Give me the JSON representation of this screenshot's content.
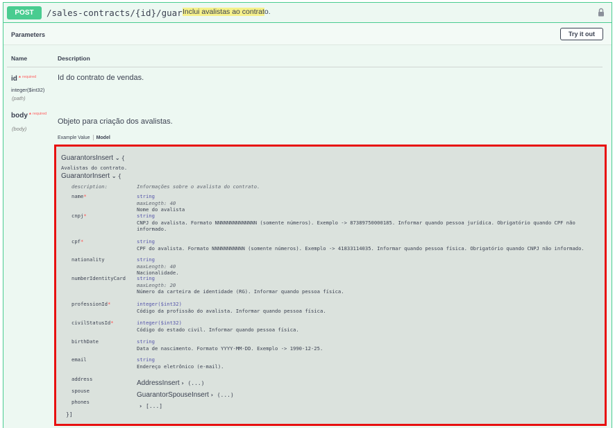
{
  "operation": {
    "method": "POST",
    "path": "/sales-contracts/{id}/guarantors",
    "summary_hl": "Inclui avalistas ao contrat",
    "summary_rest": "o.",
    "icons": {
      "lock": "lock-icon"
    },
    "colors": {
      "method": "#49cc90",
      "highlight": "#f5f08a",
      "outline": "#e81010"
    }
  },
  "parameters": {
    "title": "Parameters",
    "try_label": "Try it out",
    "col_name": "Name",
    "col_desc": "Description",
    "items": [
      {
        "name": "id",
        "star": "*",
        "required": "required",
        "type": "integer($int32)",
        "in": "(path)",
        "description": "Id do contrato de vendas."
      },
      {
        "name": "body",
        "star": "*",
        "required": "required",
        "type": "",
        "in": "(body)",
        "description": "Objeto para criação dos avalistas."
      }
    ]
  },
  "tabs": {
    "example": "Example Value",
    "model": "Model"
  },
  "model": {
    "root_name": "GuarantorsInsert",
    "root_desc": "Avalistas do contrato.",
    "item_name": "GuarantorInsert",
    "open_brace": "{",
    "close_brace": "}]",
    "description_key": "description:",
    "description_val": "Informações sobre o avalista do contrato.",
    "props": [
      {
        "name": "name",
        "star": "*",
        "type": "string",
        "extra": "maxLength: 40",
        "desc": "Nome do avalista"
      },
      {
        "name": "cnpj",
        "star": "*",
        "type": "string",
        "extra": "",
        "desc": "CNPJ do avalista. Formato NNNNNNNNNNNNNN (somente números). Exemplo -> 87389750000185. Informar quando pessoa jurídica. Obrigatório quando CPF não",
        "desc2": "informado."
      },
      {
        "name": "cpf",
        "star": "*",
        "type": "string",
        "extra": "",
        "desc": "CPF do avalista. Formato NNNNNNNNNNN (somente números). Exemplo -> 41833114035. Informar quando pessoa física. Obrigatório quando CNPJ não informado."
      },
      {
        "name": "nationality",
        "star": "",
        "type": "string",
        "extra": "maxLength: 40",
        "desc": "Nacionalidade."
      },
      {
        "name": "numberIdentityCard",
        "star": "",
        "type": "string",
        "extra": "maxLength: 20",
        "desc": "Número da carteira de identidade (RG). Informar quando pessoa física."
      },
      {
        "name": "professionId",
        "star": "*",
        "type": "integer($int32)",
        "extra": "",
        "desc": "Código da profissão do avalista. Informar quando pessoa física."
      },
      {
        "name": "civilStatusId",
        "star": "*",
        "type": "integer($int32)",
        "extra": "",
        "desc": "Código do estado civil. Informar quando pessoa física."
      },
      {
        "name": "birthDate",
        "star": "",
        "type": "string",
        "extra": "",
        "desc": "Data de nascimento. Formato YYYY-MM-DD. Exemplo -> 1990-12-25."
      },
      {
        "name": "email",
        "star": "",
        "type": "string",
        "extra": "",
        "desc": "Endereço eletrônico (e-mail)."
      }
    ],
    "refs": [
      {
        "name": "address",
        "target": "AddressInsert",
        "tail": "(...)"
      },
      {
        "name": "spouse",
        "target": "GuarantorSpouseInsert",
        "tail": "(...)"
      },
      {
        "name": "phones",
        "target": "",
        "tail": "[...]"
      }
    ]
  }
}
